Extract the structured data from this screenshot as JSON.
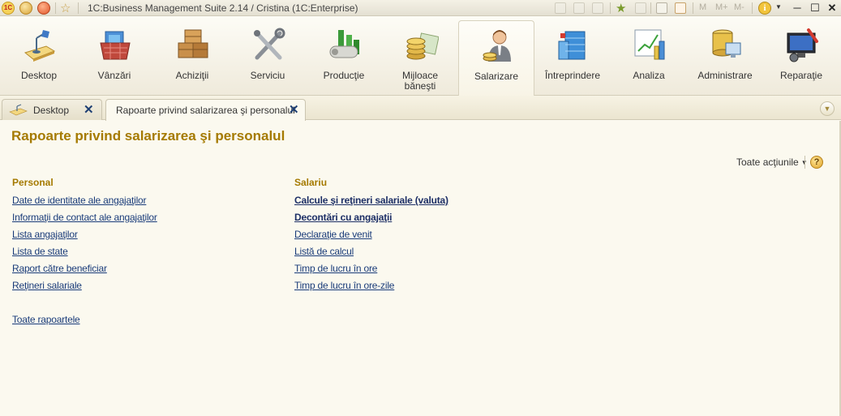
{
  "titlebar": {
    "logo_text": "1C",
    "title": "1C:Business Management Suite 2.14 / Cristina  (1C:Enterprise)",
    "m_labels": [
      "M",
      "M+",
      "M-"
    ],
    "info_glyph": "i"
  },
  "sections": [
    {
      "label": "Desktop",
      "icon": "desktop-icon"
    },
    {
      "label": "Vânzări",
      "icon": "sales-basket-icon"
    },
    {
      "label": "Achiziţii",
      "icon": "purchases-boxes-icon"
    },
    {
      "label": "Serviciu",
      "icon": "service-tools-icon"
    },
    {
      "label": "Producţie",
      "icon": "production-factory-icon"
    },
    {
      "label": "Mijloace băneşti",
      "icon": "money-coins-icon"
    },
    {
      "label": "Salarizare",
      "icon": "salary-person-icon",
      "active": true
    },
    {
      "label": "Întreprindere",
      "icon": "enterprise-building-icon"
    },
    {
      "label": "Analiza",
      "icon": "analysis-chart-icon"
    },
    {
      "label": "Administrare",
      "icon": "administration-database-icon"
    },
    {
      "label": "Reparaţie",
      "icon": "repair-monitor-icon"
    }
  ],
  "tabs": [
    {
      "label": "Desktop",
      "active": false
    },
    {
      "label": "Rapoarte privind salarizarea şi personalul",
      "active": true
    }
  ],
  "page": {
    "title": "Rapoarte privind salarizarea şi personalul",
    "actions_label": "Toate acţiunile",
    "help_glyph": "?"
  },
  "personal": {
    "title": "Personal",
    "links": [
      "Date de identitate ale angajaţilor",
      "Informaţii de contact ale angajaţilor",
      "Lista angajaţilor",
      "Lista de state",
      "Raport către beneficiar",
      "Reţineri salariale"
    ],
    "all_reports": "Toate rapoartele"
  },
  "salariu": {
    "title": "Salariu",
    "links": [
      {
        "label": "Calcule şi reţineri salariale (valuta)",
        "bold": true
      },
      {
        "label": "Decontări cu angajaţii",
        "bold": true
      },
      {
        "label": "Declaraţie de venit",
        "bold": false
      },
      {
        "label": "Listă de calcul",
        "bold": false
      },
      {
        "label": "Timp de lucru în ore",
        "bold": false
      },
      {
        "label": "Timp de lucru în ore-zile",
        "bold": false
      }
    ]
  },
  "colors": {
    "accent": "#a57a00",
    "link": "#1a3c7a",
    "background": "#fbf9ef"
  }
}
